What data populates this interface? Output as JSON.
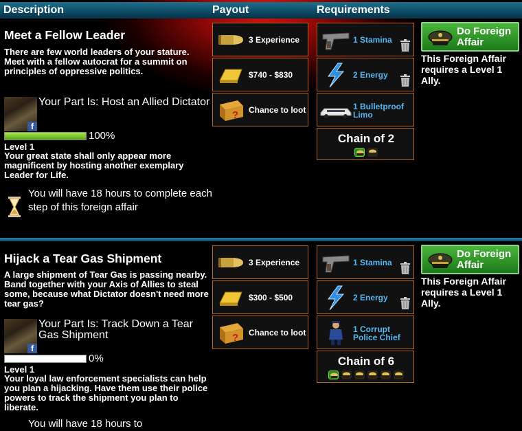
{
  "header": {
    "description": "Description",
    "payout": "Payout",
    "requirements": "Requirements"
  },
  "affairs": [
    {
      "title": "Meet a Fellow Leader",
      "description": "There are few world leaders of your stature. Meet with a fellow autocrat for a summit on principles of oppressive politics.",
      "part": "Your Part Is: Host an Allied Dictator",
      "progress_percent": 100,
      "progress_label": "100%",
      "level": "Level 1",
      "level_description": "Your great state shall only appear more magnificent by hosting another exemplary Leader for Life.",
      "timer": "You will have 18 hours to complete each step of this foreign affair",
      "payout": [
        {
          "icon": "bullet-icon",
          "label": "3 Experience"
        },
        {
          "icon": "gold-bar-icon",
          "label": "$740 - $830"
        },
        {
          "icon": "mystery-crate-icon",
          "label": "Chance to loot"
        }
      ],
      "requirements": [
        {
          "icon": "pistol-icon",
          "label": "1 Stamina"
        },
        {
          "icon": "lightning-icon",
          "label": "2 Energy"
        },
        {
          "icon": "limo-icon",
          "label": "1 Bulletproof Limo"
        }
      ],
      "chain": {
        "label": "Chain of 2",
        "total": 2,
        "completed": 1
      },
      "button": "Do Foreign Affair",
      "note": "This Foreign Affair requires a Level 1 Ally."
    },
    {
      "title": "Hijack a Tear Gas Shipment",
      "description": "A large shipment of Tear Gas is passing nearby. Band together with your Axis of Allies to steal some, because what Dictator doesn't need more tear gas?",
      "part": "Your Part Is: Track Down a Tear Gas Shipment",
      "progress_percent": 0,
      "progress_label": "0%",
      "level": "Level 1",
      "level_description": "Your loyal law enforcement specialists can help you plan a hijacking. Have them use their police powers to track the shipment you plan to liberate.",
      "timer": "You will have 18 hours to",
      "payout": [
        {
          "icon": "bullet-icon",
          "label": "3 Experience"
        },
        {
          "icon": "gold-bar-icon",
          "label": "$300 - $500"
        },
        {
          "icon": "mystery-crate-icon",
          "label": "Chance to loot"
        }
      ],
      "requirements": [
        {
          "icon": "pistol-icon",
          "label": "1 Stamina"
        },
        {
          "icon": "lightning-icon",
          "label": "2 Energy"
        },
        {
          "icon": "police-chief-icon",
          "label": "1 Corrupt Police Chief"
        }
      ],
      "chain": {
        "label": "Chain of 6",
        "total": 6,
        "completed": 1
      },
      "button": "Do Foreign Affair",
      "note": "This Foreign Affair requires a Level 1 Ally."
    }
  ],
  "colors": {
    "header": "#0d4a63",
    "box_border": "#b3662a",
    "req_text": "#53b7f2",
    "button": "#2c9a26",
    "progress": "#7fd12e"
  }
}
